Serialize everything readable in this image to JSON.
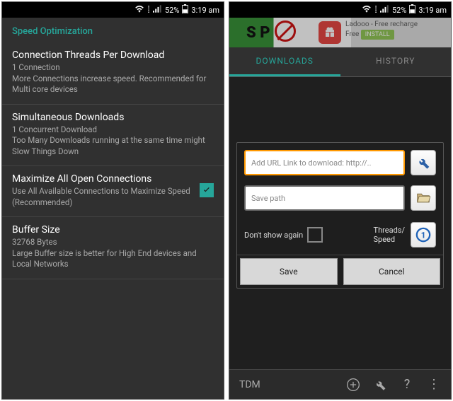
{
  "status": {
    "battery_pct": "52%",
    "time": "3:19 am"
  },
  "left": {
    "section_header": "Speed Optimization",
    "items": [
      {
        "title": "Connection Threads Per Download",
        "sub": "1 Connection\nMore Connections increase speed. Recommended for Multi core devices"
      },
      {
        "title": "Simultaneous Downloads",
        "sub": "1 Concurrent Download\nToo Many Downloads running at the same time might Slow Things Down"
      },
      {
        "title": "Maximize All Open Connections",
        "sub": "Use All Available Connections to Maximize Speed (Recommended)",
        "checked": true
      },
      {
        "title": "Buffer Size",
        "sub": "32768 Bytes\nLarge Buffer size is better for High End devices and Local Networks"
      }
    ]
  },
  "right": {
    "ad": {
      "stop_text": "S  P",
      "title": "Ladooo - Free recharge",
      "sub": "Free",
      "install": "INSTALL"
    },
    "tabs": {
      "downloads": "DOWNLOADS",
      "history": "HISTORY"
    },
    "dialog": {
      "url_placeholder": "Add URL Link to download: http://..",
      "path_placeholder": "Save path",
      "dont_show": "Don't show again",
      "threads_label": "Threads/\nSpeed",
      "save": "Save",
      "cancel": "Cancel"
    },
    "bottom": {
      "app_label": "TDM"
    }
  }
}
